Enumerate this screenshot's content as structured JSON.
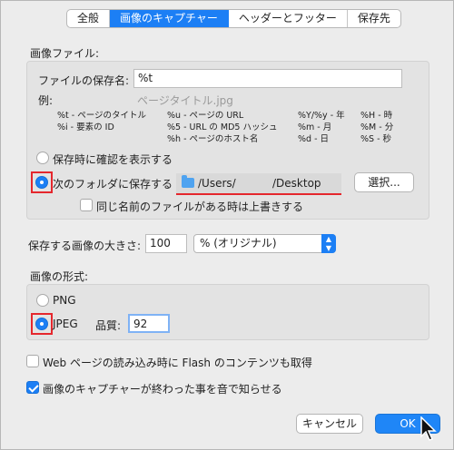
{
  "tabs": [
    {
      "label": "全般",
      "active": false
    },
    {
      "label": "画像のキャプチャー",
      "active": true
    },
    {
      "label": "ヘッダーとフッター",
      "active": false
    },
    {
      "label": "保存先",
      "active": false
    }
  ],
  "image_file": {
    "section_title": "画像ファイル:",
    "filename_label": "ファイルの保存名:",
    "filename_value": "%t",
    "example_label": "例:",
    "example_value": "ページタイトル.jpg",
    "tokens": [
      [
        "%t - ページのタイトル",
        "%u - ページの URL",
        "%Y/%y - 年",
        "%H - 時"
      ],
      [
        "%i - 要素の ID",
        "%5 - URL の MD5 ハッシュ",
        "%m - 月",
        "%M - 分"
      ],
      [
        "",
        "%h - ページのホスト名",
        "%d - 日",
        "%S - 秒"
      ]
    ],
    "radio_confirm_label": "保存時に確認を表示する",
    "radio_folder_label": "次のフォルダに保存する",
    "path_prefix": "/Users/",
    "path_suffix": "/Desktop",
    "choose_button": "選択...",
    "overwrite_label": "同じ名前のファイルがある時は上書きする"
  },
  "size": {
    "label": "保存する画像の大きさ:",
    "value": "100",
    "unit_selected": "% (オリジナル)"
  },
  "format": {
    "section_title": "画像の形式:",
    "png_label": "PNG",
    "jpeg_label": "JPEG",
    "quality_label": "品質:",
    "quality_value": "92"
  },
  "options": {
    "flash_label": "Web ページの読み込み時に Flash のコンテンツも取得",
    "flash_checked": false,
    "sound_label": "画像のキャプチャーが終わった事を音で知らせる",
    "sound_checked": true
  },
  "footer": {
    "cancel": "キャンセル",
    "ok": "OK"
  },
  "colors": {
    "accent": "#1c7ff5",
    "highlight": "#e5272d"
  }
}
